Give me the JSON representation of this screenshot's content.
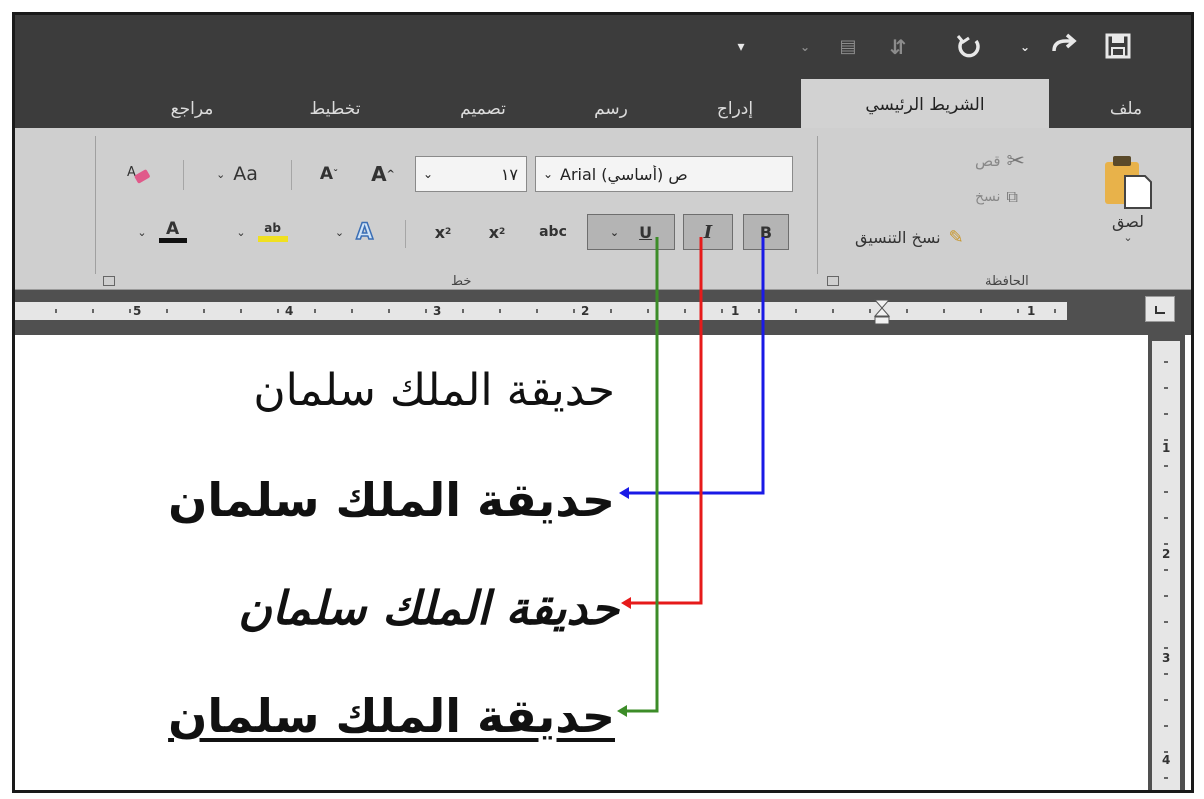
{
  "qat": {
    "save_icon": "save-icon",
    "redo_icon": "redo-icon",
    "undo_icon": "undo-icon",
    "dropdown_icon": "chevron-down-icon"
  },
  "tabs": {
    "file": "ملف",
    "home": "الشريط الرئيسي",
    "insert": "إدراج",
    "draw": "رسم",
    "design": "تصميم",
    "layout": "تخطيط",
    "references": "مراجع"
  },
  "clipboard": {
    "paste": "لصق",
    "cut": "قص",
    "copy": "نسخ",
    "format_painter": "نسخ التنسيق",
    "group_label": "الحافظة"
  },
  "font": {
    "font_name": "Arial (أساسي) ص",
    "font_size": "١٧",
    "change_case": "Aa",
    "grow": "A",
    "shrink": "A",
    "bold": "B",
    "italic": "I",
    "underline": "U",
    "strike": "abc",
    "subscript": "x",
    "superscript": "x",
    "highlight": "ab",
    "group_label": "خط"
  },
  "ruler": {
    "numbers": [
      "5",
      "4",
      "3",
      "2",
      "1",
      "1"
    ]
  },
  "vertical_ruler": {
    "numbers": [
      "1",
      "2",
      "3",
      "4"
    ]
  },
  "document": {
    "line_normal": "حديقة الملك سلمان",
    "line_bold": "حديقة الملك سلمان",
    "line_italic": "حديقة الملك سلمان",
    "line_underline": "حديقة الملك سلمان"
  },
  "colors": {
    "bold_arrow": "#1a1ae6",
    "italic_arrow": "#e61a1a",
    "underline_arrow": "#3c8c28",
    "highlight": "#f0e020"
  }
}
